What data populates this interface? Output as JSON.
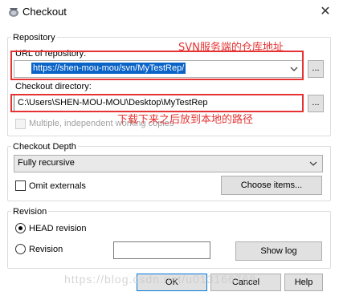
{
  "window": {
    "title": "Checkout"
  },
  "repository": {
    "group_title": "Repository",
    "url_label": "URL of repository:",
    "url_value": "https://shen-mou-mou/svn/MyTestRep/",
    "browse_label": "...",
    "checkout_dir_label": "Checkout directory:",
    "checkout_dir_value": "C:\\Users\\SHEN-MOU-MOU\\Desktop\\MyTestRep",
    "multiple_label": "Multiple, independent working copies",
    "multiple_checked": false
  },
  "depth": {
    "group_title": "Checkout Depth",
    "selected": "Fully recursive",
    "omit_externals_label": "Omit externals",
    "omit_externals_checked": false,
    "choose_items_label": "Choose items..."
  },
  "revision": {
    "group_title": "Revision",
    "head_label": "HEAD revision",
    "revision_label": "Revision",
    "selected": "HEAD revision",
    "revision_value": "",
    "show_log_label": "Show log"
  },
  "buttons": {
    "ok": "OK",
    "cancel": "Cancel",
    "help": "Help"
  },
  "annotations": {
    "svn_address": "SVN服务端的仓库地址",
    "local_path": "下载下来之后放到本地的路径"
  },
  "watermark": "https://blog.csdn.net/u013166769",
  "colors": {
    "annotation": "#e53333",
    "selection": "#0a64c8"
  }
}
